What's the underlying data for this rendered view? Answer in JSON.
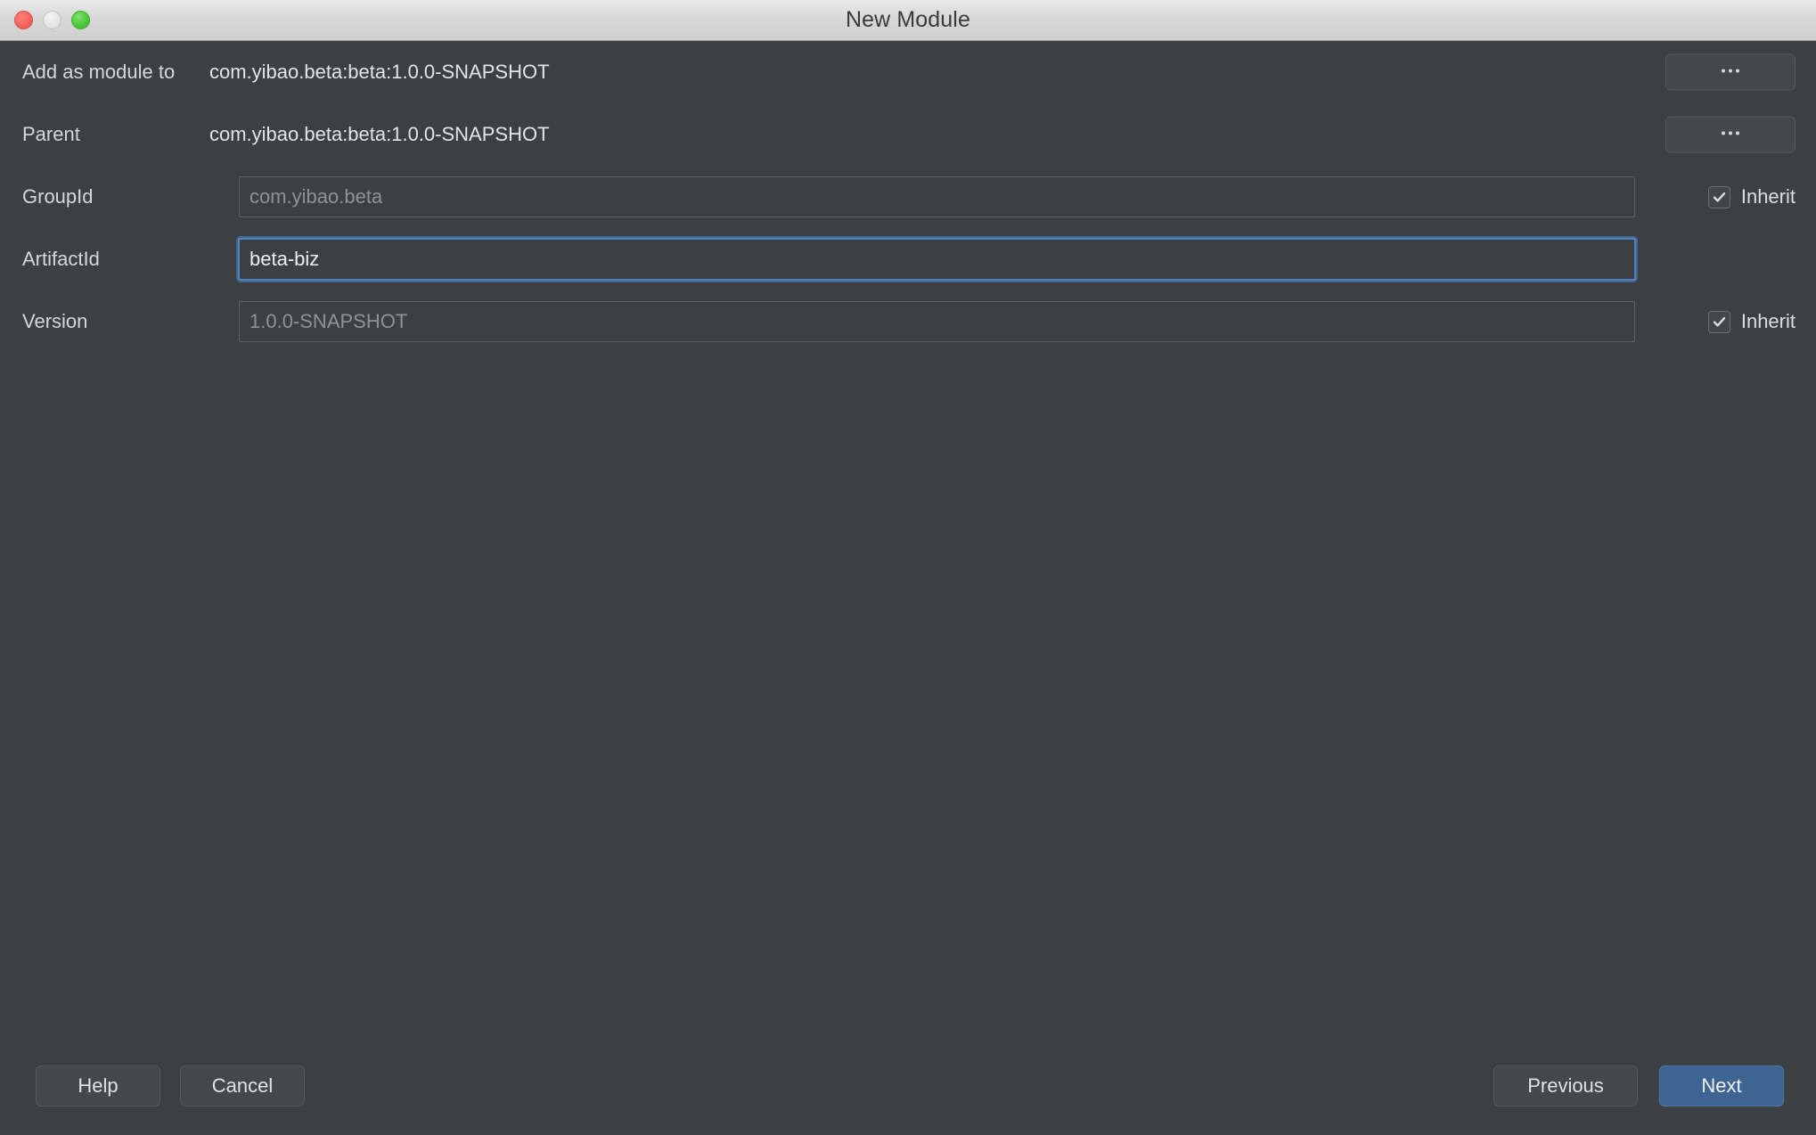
{
  "window": {
    "title": "New Module",
    "traffic_lights": [
      {
        "name": "close",
        "color": "#f6655c"
      },
      {
        "name": "minimize",
        "color": "#e4e4e4"
      },
      {
        "name": "maximize",
        "color": "#4ec93a"
      }
    ],
    "background_color": "#3d4043",
    "accent_color": "#3d6493",
    "focus_color": "#4a86c5"
  },
  "form": {
    "rows": [
      {
        "label": "Add as module to",
        "type": "static",
        "value": "com.yibao.beta:beta:1.0.0-SNAPSHOT",
        "trailing": "ellipsis-button",
        "trailing_label": "..."
      },
      {
        "label": "Parent",
        "type": "static",
        "value": "com.yibao.beta:beta:1.0.0-SNAPSHOT",
        "trailing": "ellipsis-button",
        "trailing_label": "..."
      },
      {
        "label": "GroupId",
        "type": "input",
        "value": "com.yibao.beta",
        "placeholder": "com.yibao.beta",
        "state": "disabled",
        "trailing": "checkbox",
        "trailing_label": "Inherit",
        "checked": true
      },
      {
        "label": "ArtifactId",
        "type": "input",
        "value": "beta-biz",
        "placeholder": "beta-biz",
        "state": "focused",
        "trailing": "none"
      },
      {
        "label": "Version",
        "type": "input",
        "value": "1.0.0-SNAPSHOT",
        "placeholder": "1.0.0-SNAPSHOT",
        "state": "disabled",
        "trailing": "checkbox",
        "trailing_label": "Inherit",
        "checked": true
      }
    ]
  },
  "footer": {
    "help_label": "Help",
    "cancel_label": "Cancel",
    "previous_label": "Previous",
    "next_label": "Next"
  }
}
